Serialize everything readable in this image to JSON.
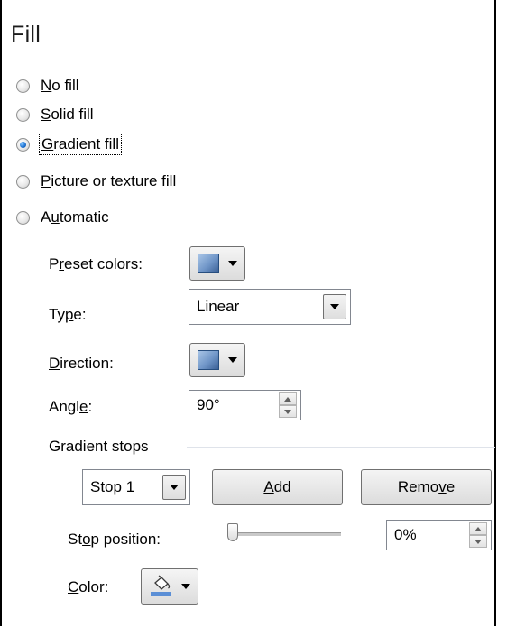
{
  "heading": "Fill",
  "fill_options": [
    {
      "label": "No fill",
      "accel": "N",
      "rest": "o fill",
      "selected": false
    },
    {
      "label": "Solid fill",
      "accel": "S",
      "rest": "olid fill",
      "selected": false
    },
    {
      "label": "Gradient fill",
      "accel": "G",
      "rest": "radient fill",
      "selected": true
    },
    {
      "label": "Picture or texture fill",
      "accel": "P",
      "rest": "icture or texture fill",
      "selected": false
    },
    {
      "label": "Automatic",
      "pre": "A",
      "accel": "u",
      "rest": "tomatic",
      "selected": false
    }
  ],
  "preset_colors": {
    "pre": "P",
    "accel": "r",
    "rest": "eset colors:"
  },
  "type": {
    "pre": "Ty",
    "accel": "p",
    "rest": "e:",
    "value": "Linear"
  },
  "direction": {
    "pre": "",
    "accel": "D",
    "rest": "irection:"
  },
  "angle": {
    "pre": "Angl",
    "accel": "e",
    "rest": ":",
    "value": "90°"
  },
  "gradient_stops": {
    "title": "Gradient stops",
    "selected_stop": "Stop 1",
    "add_accel": "A",
    "add_rest": "dd",
    "remove_pre": "Remo",
    "remove_accel": "v",
    "remove_rest": "e"
  },
  "stop_position": {
    "pre": "St",
    "accel": "o",
    "rest": "p position:",
    "value": "0%",
    "level_percent": 0
  },
  "color": {
    "pre": "",
    "accel": "C",
    "rest": "olor:"
  },
  "colors": {
    "radio_selected": "#1a6fd0",
    "swatch": "#6f95c7",
    "paint_fill": "#5b8fd6"
  }
}
